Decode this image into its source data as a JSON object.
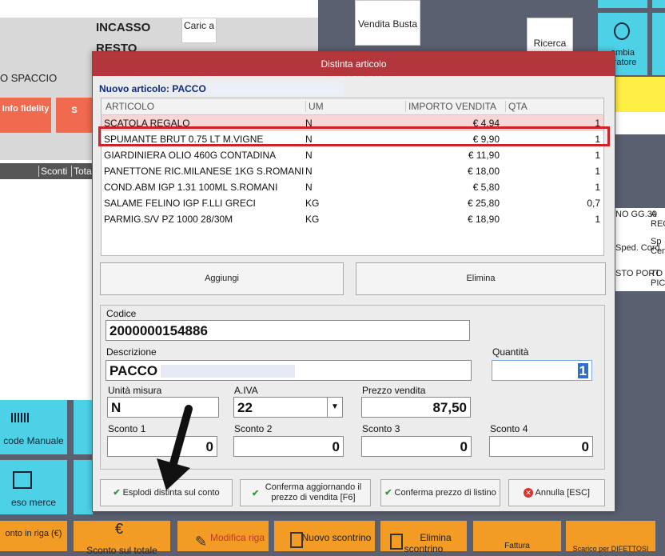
{
  "app": {
    "incasso_label": "INCASSO",
    "resto_label": "RESTO",
    "carica_label": "Caric a",
    "spaccio_label": "O SPACCIO",
    "info_fidelity_label": "Info fidelity",
    "s_tile_label": "S",
    "sconti_label": "Sconti",
    "tota_label": "Tota",
    "vendita_busta_label": "Vendita Busta",
    "ricerca_label": "Ricerca",
    "cambia_operatore_label": "ambia eratore",
    "barcode_manuale_label": "code Manuale",
    "reso_merce_label": "eso merce",
    "sconto_riga_label": "onto in riga (€)",
    "sconto_totale_label": "Sconto sul totale",
    "modifica_riga_label": "Modifica riga",
    "nuovo_scontrino_label": "Nuovo scontrino",
    "elimina_scontrino_label": "Elimina scontrino",
    "fattura_label": "Fattura",
    "scarico_label": "Scarico per DIFETTOSI",
    "right_cells": [
      "NO GG.30",
      "A REG",
      "Sped. Cord",
      "Sp Cen",
      "STO PORT",
      "TO PICO"
    ]
  },
  "dialog": {
    "title": "Distinta articolo",
    "new_item_label": "Nuovo articolo: PACCO",
    "columns": [
      "ARTICOLO",
      "UM",
      "IMPORTO VENDITA",
      "QTA"
    ],
    "rows": [
      {
        "articolo": "SCATOLA REGALO",
        "um": "N",
        "importo": "€ 4,94",
        "qta": "1"
      },
      {
        "articolo": "SPUMANTE BRUT 0.75 LT M.VIGNE",
        "um": "N",
        "importo": "€ 9,90",
        "qta": "1"
      },
      {
        "articolo": "GIARDINIERA OLIO 460G CONTADINA",
        "um": "N",
        "importo": "€ 11,90",
        "qta": "1"
      },
      {
        "articolo": "PANETTONE RIC.MILANESE 1KG S.ROMANI",
        "um": "N",
        "importo": "€ 18,00",
        "qta": "1"
      },
      {
        "articolo": "COND.ABM IGP 1.31 100ML S.ROMANI",
        "um": "N",
        "importo": "€ 5,80",
        "qta": "1"
      },
      {
        "articolo": "SALAME FELINO IGP F.LLI GRECI",
        "um": "KG",
        "importo": "€ 25,80",
        "qta": "0,7"
      },
      {
        "articolo": "PARMIG.S/V PZ 1000 28/30M",
        "um": "KG",
        "importo": "€ 18,90",
        "qta": "1"
      }
    ],
    "aggiungi_label": "Aggiungi",
    "elimina_label": "Elimina",
    "codice_label": "Codice",
    "codice_value": "2000000154886",
    "descrizione_label": "Descrizione",
    "descrizione_value": "PACCO",
    "quantita_label": "Quantità",
    "quantita_value": "1",
    "unita_label": "Unità misura",
    "unita_value": "N",
    "aiva_label": "A.IVA",
    "aiva_value": "22",
    "prezzo_label": "Prezzo vendita",
    "prezzo_value": "87,50",
    "sconto1_label": "Sconto 1",
    "sconto1_value": "0",
    "sconto2_label": "Sconto 2",
    "sconto2_value": "0",
    "sconto3_label": "Sconto 3",
    "sconto3_value": "0",
    "sconto4_label": "Sconto 4",
    "sconto4_value": "0",
    "esplodi_label": "Esplodi distinta sul conto",
    "conferma_agg_label": "Conferma aggiornando il prezzo di vendita [F6]",
    "conferma_listino_label": "Conferma prezzo di listino",
    "annulla_label": "Annulla [ESC]"
  }
}
